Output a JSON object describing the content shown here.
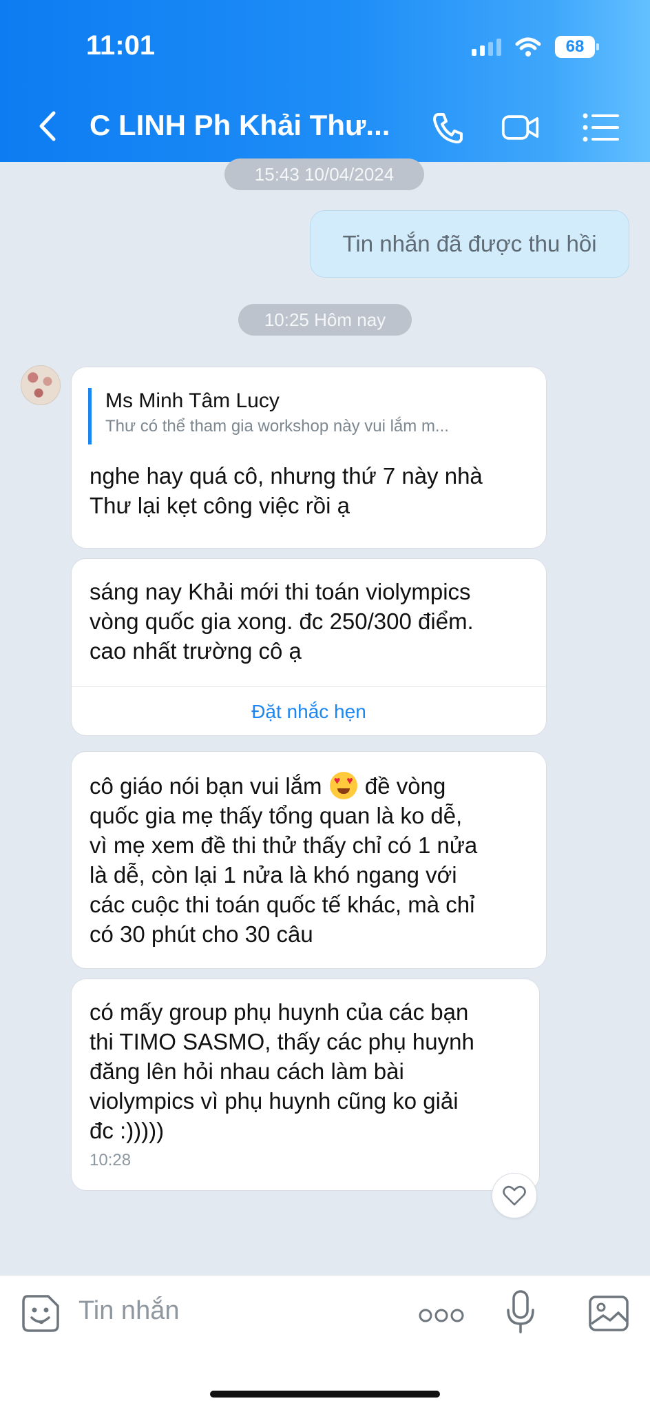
{
  "status_bar": {
    "time": "11:01",
    "battery": "68"
  },
  "header": {
    "title": "C LINH Ph Khải Thư..."
  },
  "timestamps": [
    "15:43 10/04/2024",
    "10:25 Hôm nay"
  ],
  "messages": {
    "recalled": "Tin nhắn đã được thu hồi",
    "reply": {
      "quote_author": "Ms Minh Tâm Lucy",
      "quote_text": "Thư có thể tham gia workshop này vui lắm m...",
      "text": "nghe hay quá cô, nhưng thứ 7 này nhà\nThư lại kẹt công việc rồi ạ"
    },
    "second": {
      "text": "sáng nay Khải mới thi toán violympics\nvòng quốc gia xong. đc 250/300 điểm.\ncao nhất trường cô ạ",
      "action": "Đặt nhắc hẹn"
    },
    "third": {
      "text_before_emoji": "cô giáo nói bạn vui lắm",
      "emoji": "heart-eyes-emoji",
      "text_after_emoji": " đề vòng\nquốc gia mẹ thấy tổng quan là ko dễ,\nvì mẹ xem đề thi thử thấy chỉ có 1 nửa\nlà dễ, còn lại 1 nửa là khó ngang với\ncác cuộc thi toán quốc tế khác, mà chỉ\ncó 30 phút cho 30 câu"
    },
    "fourth": {
      "text": "có mấy group phụ huynh của các bạn\nthi TIMO SASMO, thấy các phụ huynh\nđăng lên hỏi nhau cách làm bài\nviolympics vì phụ huynh cũng ko giải\nđc :)))))",
      "time": "10:28"
    }
  },
  "input": {
    "placeholder": "Tin nhắn"
  },
  "icons": [
    "back-icon",
    "phone-icon",
    "video-icon",
    "menu-icon",
    "heart-icon",
    "sticker-icon",
    "more-icon",
    "mic-icon",
    "image-icon"
  ]
}
